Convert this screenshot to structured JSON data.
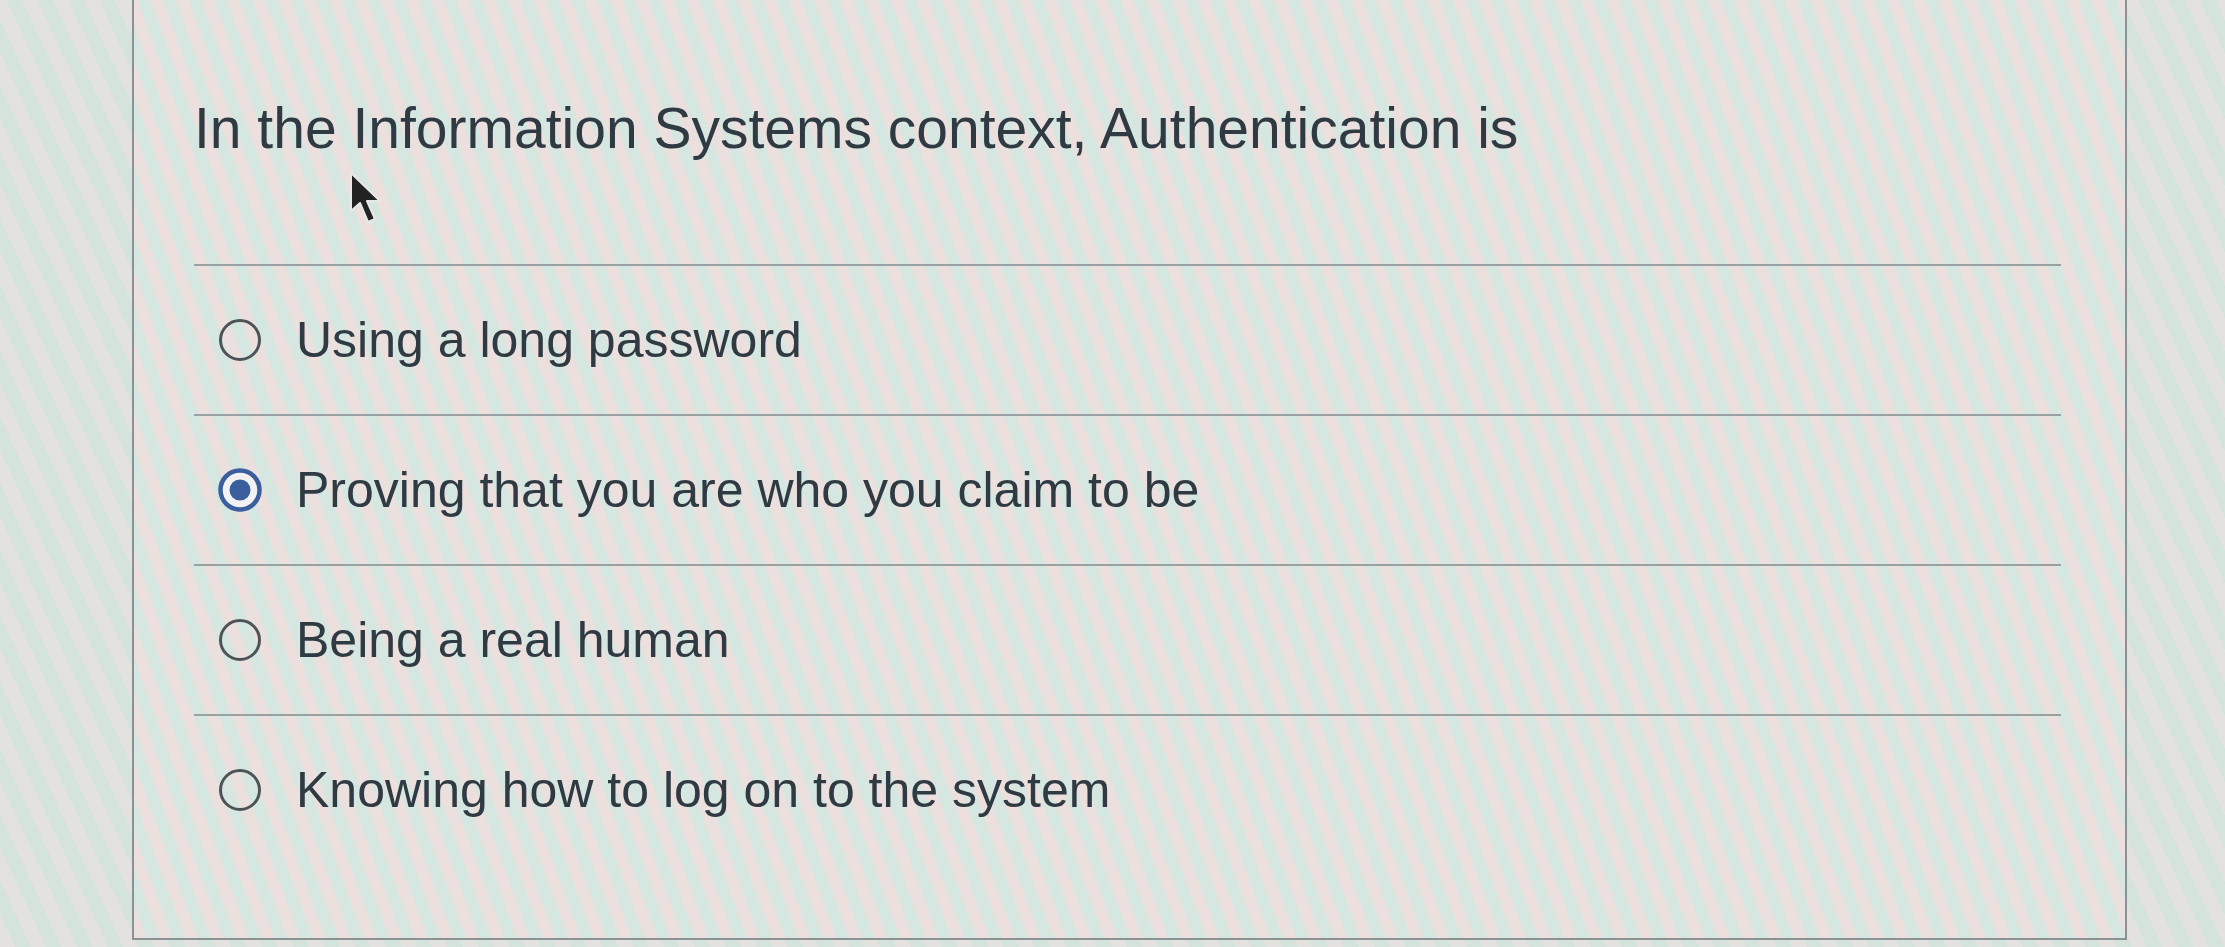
{
  "question": {
    "text": "In the Information Systems context, Authentication is"
  },
  "options": [
    {
      "label": "Using a long password",
      "selected": false
    },
    {
      "label": "Proving that you are who you claim to be",
      "selected": true
    },
    {
      "label": "Being a real human",
      "selected": false
    },
    {
      "label": "Knowing how to log on to the system",
      "selected": false
    }
  ]
}
